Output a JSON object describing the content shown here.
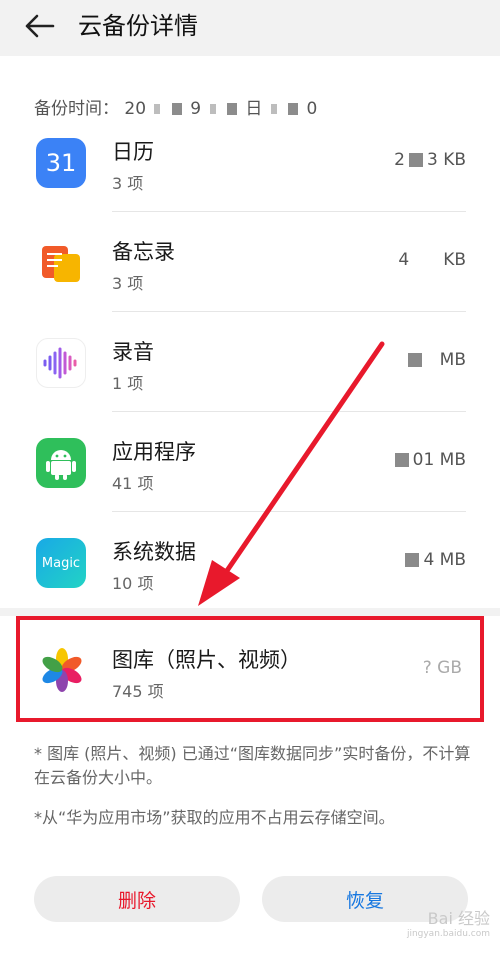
{
  "header": {
    "title": "云备份详情",
    "back_icon": "arrow-left-icon"
  },
  "backup_time": {
    "label": "备份时间：",
    "value_parts": [
      "20",
      "9",
      "日",
      "0"
    ]
  },
  "items": [
    {
      "name": "日历",
      "count": "3 项",
      "size_prefix": "2",
      "size_suffix": "3 KB",
      "icon": "calendar-icon",
      "icon_text": "31",
      "color": "#3b82f6"
    },
    {
      "name": "备忘录",
      "count": "3 项",
      "size_prefix": "4",
      "size_suffix": "KB",
      "icon": "notes-icon",
      "color": "#f39c12"
    },
    {
      "name": "录音",
      "count": "1 项",
      "size_prefix": "",
      "size_suffix": "MB",
      "icon": "recorder-icon",
      "color": "#7b5cf0"
    },
    {
      "name": "应用程序",
      "count": "41 项",
      "size_prefix": "",
      "size_suffix": "01 MB",
      "icon": "android-icon",
      "color": "#2fbf5b"
    },
    {
      "name": "系统数据",
      "count": "10 项",
      "size_prefix": "",
      "size_suffix": "4 MB",
      "icon": "magic-icon",
      "icon_text": "Magic",
      "color": "#1ec0d6"
    }
  ],
  "gallery": {
    "name": "图库（照片、视频）",
    "count": "745 项",
    "size": "? GB",
    "icon": "gallery-icon"
  },
  "notes": [
    "* 图库 (照片、视频) 已通过“图库数据同步”实时备份，不计算在云备份大小中。",
    "*从“华为应用市场”获取的应用不占用云存储空间。"
  ],
  "buttons": {
    "delete": "删除",
    "restore": "恢复"
  },
  "colors": {
    "highlight": "#e8192c",
    "delete": "#e8192c",
    "restore": "#1677e0"
  },
  "watermark": {
    "text": "Bai 经验",
    "sub": "jingyan.baidu.com"
  }
}
